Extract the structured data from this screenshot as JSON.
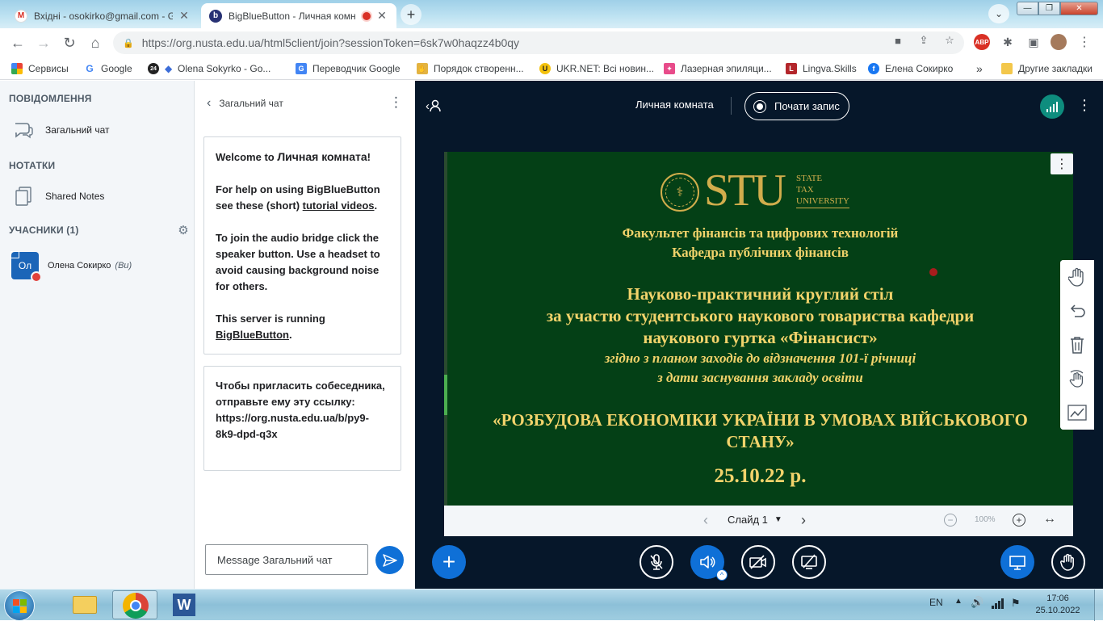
{
  "browser": {
    "tabs": [
      {
        "title": "Вхідні - osokirko@gmail.com - G",
        "favicon": "gmail-icon"
      },
      {
        "title": "BigBlueButton - Личная комн",
        "favicon": "bigbluebutton-icon",
        "recording": true
      }
    ],
    "url": "https://org.nusta.edu.ua/html5client/join?sessionToken=6sk7w0haqzz4b0qy",
    "bookmarks": [
      "Сервисы",
      "Google",
      "Olena Sokyrko - Go...",
      "Переводчик Google",
      "Порядок створенн...",
      "UKR.NET: Всі новин...",
      "Лазерная эпиляци...",
      "Lingva.Skills",
      "Елена Сокирко"
    ],
    "bookmarks_more": "»",
    "other_bookmarks": "Другие закладки",
    "extension_badge": "ABP"
  },
  "userlist": {
    "messages_header": "ПОВІДОМЛЕННЯ",
    "public_chat": "Загальний чат",
    "notes_header": "НОТАТКИ",
    "shared_notes": "Shared Notes",
    "users_header": "УЧАСНИКИ (1)",
    "user": {
      "initials": "Ол",
      "name": "Олена Сокирко",
      "you": "(Ви)"
    }
  },
  "chat": {
    "title": "Загальний чат",
    "welcome_prefix": "Welcome to ",
    "welcome_room": "Личная комната",
    "welcome_suffix": "!",
    "help_text": "For help on using BigBlueButton see these (short) ",
    "help_link": "tutorial videos",
    "audio_text": "To join the audio bridge click the speaker button. Use a headset to avoid causing background noise for others.",
    "server_text": "This server is running ",
    "server_link": "BigBlueButton",
    "invite_text": "Чтобы пригласить собеседника, отправьте ему эту ссылку: https://org.nusta.edu.ua/b/py9-8k9-dpd-q3x",
    "input_placeholder": "Message Загальний чат"
  },
  "header": {
    "room_name": "Личная комната",
    "record_label": "Почати запис"
  },
  "slide": {
    "logo_text": "STU",
    "logo_sub": [
      "STATE",
      "TAX",
      "UNIVERSITY"
    ],
    "faculty": "Факультет фінансів та цифрових технологій",
    "department": "Кафедра публічних фінансів",
    "line1": "Науково-практичний круглий стіл",
    "line2": "за участю студентського наукового товариства кафедри",
    "line3": "наукового гуртка «Фінансист»",
    "line4": "згідно з планом заходів до відзначення 101-ї річниці",
    "line5": "з дати заснування закладу освіти",
    "topic_line1": "«РОЗБУДОВА ЕКОНОМІКИ УКРАЇНИ В УМОВАХ ВІЙСЬКОВОГО",
    "topic_line2": "СТАНУ»",
    "date": "25.10.22 р.",
    "colors": {
      "background": "#044016",
      "text": "#f2d36b"
    }
  },
  "slide_nav": {
    "slide_label": "Слайд 1",
    "zoom": "100%"
  },
  "taskbar": {
    "lang": "EN",
    "time": "17:06",
    "date": "25.10.2022"
  },
  "colors": {
    "accent": "#0f70d7",
    "main_bg": "#06172a",
    "sidebar_bg": "#f3f6f9"
  }
}
